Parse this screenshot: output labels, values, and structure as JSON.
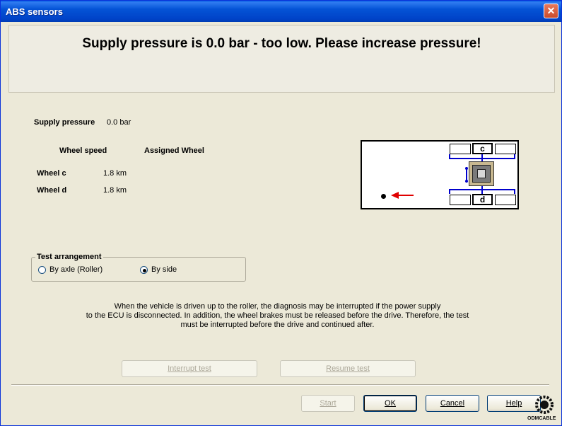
{
  "window": {
    "title": "ABS sensors",
    "close_label": "✕"
  },
  "banner": {
    "message": "Supply pressure is  0.0 bar - too low. Please increase pressure!"
  },
  "supply": {
    "label": "Supply pressure",
    "value": "0.0 bar"
  },
  "table": {
    "headers": [
      "Wheel speed",
      "Assigned Wheel"
    ],
    "rows": [
      {
        "name": "Wheel c",
        "speed": "1.8 km",
        "assigned": ""
      },
      {
        "name": "Wheel d",
        "speed": "1.8 km",
        "assigned": ""
      }
    ]
  },
  "diagram": {
    "top_wheel": "c",
    "bottom_wheel": "d",
    "arrow_color": "#e00000",
    "line_color": "#0000cc"
  },
  "test_arrangement": {
    "title": "Test arrangement",
    "options": [
      {
        "label": "By axle (Roller)",
        "selected": false
      },
      {
        "label": "By side",
        "selected": true
      }
    ]
  },
  "note": {
    "lines": [
      "When the vehicle is driven up to the roller, the diagnosis may be interrupted if the power supply",
      "to the ECU is disconnected. In addition, the wheel brakes must be released before the drive. Therefore, the test",
      "must be interrupted before the drive and continued after."
    ]
  },
  "buttons": {
    "interrupt": {
      "label": "Interrupt test",
      "enabled": false
    },
    "resume": {
      "label": "Resume test",
      "enabled": false
    },
    "start": {
      "label": "Start",
      "enabled": false
    },
    "ok": {
      "label": "OK",
      "enabled": true
    },
    "cancel": {
      "label": "Cancel",
      "enabled": true
    },
    "help": {
      "label": "Help",
      "enabled": true
    }
  },
  "logo": {
    "text": "ODMCABLE"
  }
}
